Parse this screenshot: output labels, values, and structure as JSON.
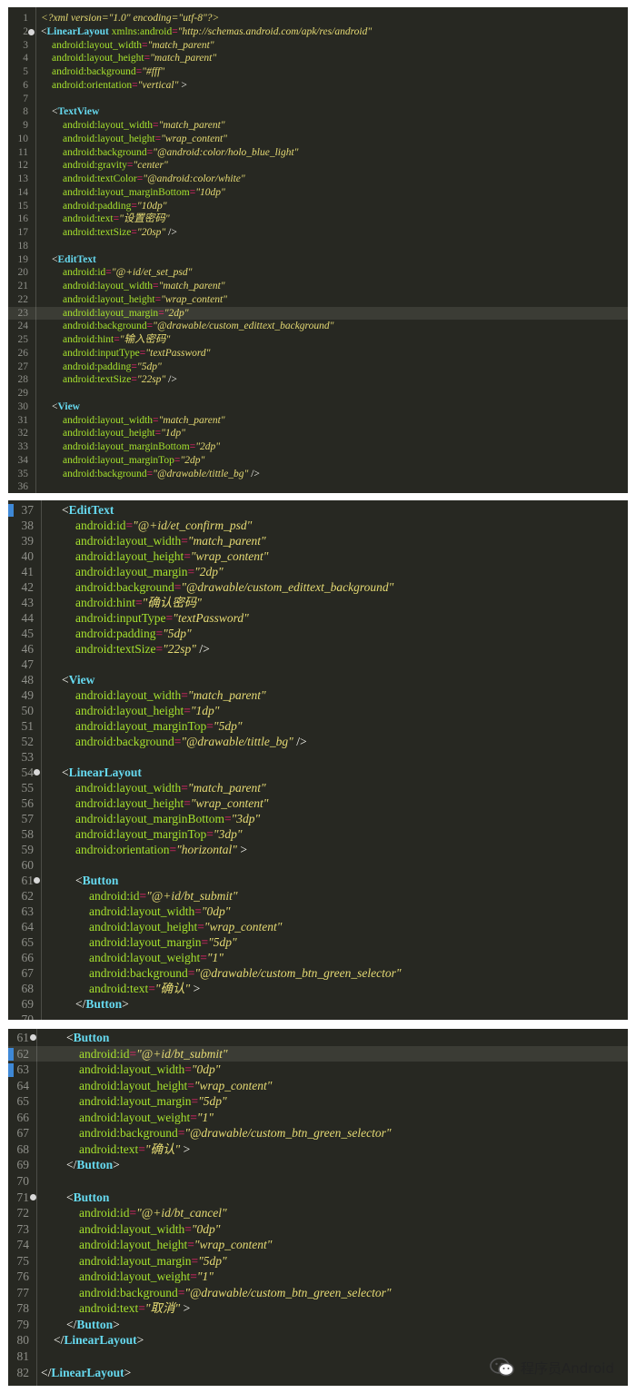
{
  "panels": [
    {
      "lines": [
        {
          "n": "1",
          "c": "decl",
          "text": "<?xml version=\"1.0\" encoding=\"utf-8\"?>"
        },
        {
          "n": "2",
          "c": "open",
          "indent": 0,
          "tag": "LinearLayout",
          "attr": "xmlns:android",
          "val": "\"http://schemas.android.com/apk/res/android\"",
          "fold": true
        },
        {
          "n": "3",
          "c": "attr",
          "indent": 1,
          "attr": "android:layout_width",
          "val": "\"match_parent\""
        },
        {
          "n": "4",
          "c": "attr",
          "indent": 1,
          "attr": "android:layout_height",
          "val": "\"match_parent\""
        },
        {
          "n": "5",
          "c": "attr",
          "indent": 1,
          "attr": "android:background",
          "val": "\"#fff\""
        },
        {
          "n": "6",
          "c": "attr",
          "indent": 1,
          "attr": "android:orientation",
          "val": "\"vertical\"",
          "end": " >"
        },
        {
          "n": "7",
          "c": "blank"
        },
        {
          "n": "8",
          "c": "open",
          "indent": 1,
          "tag": "TextView"
        },
        {
          "n": "9",
          "c": "attr",
          "indent": 2,
          "attr": "android:layout_width",
          "val": "\"match_parent\""
        },
        {
          "n": "10",
          "c": "attr",
          "indent": 2,
          "attr": "android:layout_height",
          "val": "\"wrap_content\""
        },
        {
          "n": "11",
          "c": "attr",
          "indent": 2,
          "attr": "android:background",
          "val": "\"@android:color/holo_blue_light\""
        },
        {
          "n": "12",
          "c": "attr",
          "indent": 2,
          "attr": "android:gravity",
          "val": "\"center\""
        },
        {
          "n": "13",
          "c": "attr",
          "indent": 2,
          "attr": "android:textColor",
          "val": "\"@android:color/white\""
        },
        {
          "n": "14",
          "c": "attr",
          "indent": 2,
          "attr": "android:layout_marginBottom",
          "val": "\"10dp\""
        },
        {
          "n": "15",
          "c": "attr",
          "indent": 2,
          "attr": "android:padding",
          "val": "\"10dp\""
        },
        {
          "n": "16",
          "c": "attr",
          "indent": 2,
          "attr": "android:text",
          "val": "\"设置密码\""
        },
        {
          "n": "17",
          "c": "attr",
          "indent": 2,
          "attr": "android:textSize",
          "val": "\"20sp\"",
          "end": " />"
        },
        {
          "n": "18",
          "c": "blank"
        },
        {
          "n": "19",
          "c": "open",
          "indent": 1,
          "tag": "EditText"
        },
        {
          "n": "20",
          "c": "attr",
          "indent": 2,
          "attr": "android:id",
          "val": "\"@+id/et_set_psd\""
        },
        {
          "n": "21",
          "c": "attr",
          "indent": 2,
          "attr": "android:layout_width",
          "val": "\"match_parent\""
        },
        {
          "n": "22",
          "c": "attr",
          "indent": 2,
          "attr": "android:layout_height",
          "val": "\"wrap_content\""
        },
        {
          "n": "23",
          "c": "attr",
          "indent": 2,
          "attr": "android:layout_margin",
          "val": "\"2dp\"",
          "hl": true
        },
        {
          "n": "24",
          "c": "attr",
          "indent": 2,
          "attr": "android:background",
          "val": "\"@drawable/custom_edittext_background\""
        },
        {
          "n": "25",
          "c": "attr",
          "indent": 2,
          "attr": "android:hint",
          "val": "\"输入密码\""
        },
        {
          "n": "26",
          "c": "attr",
          "indent": 2,
          "attr": "android:inputType",
          "val": "\"textPassword\""
        },
        {
          "n": "27",
          "c": "attr",
          "indent": 2,
          "attr": "android:padding",
          "val": "\"5dp\""
        },
        {
          "n": "28",
          "c": "attr",
          "indent": 2,
          "attr": "android:textSize",
          "val": "\"22sp\"",
          "end": " />"
        },
        {
          "n": "29",
          "c": "blank"
        },
        {
          "n": "30",
          "c": "open",
          "indent": 1,
          "tag": "View"
        },
        {
          "n": "31",
          "c": "attr",
          "indent": 2,
          "attr": "android:layout_width",
          "val": "\"match_parent\""
        },
        {
          "n": "32",
          "c": "attr",
          "indent": 2,
          "attr": "android:layout_height",
          "val": "\"1dp\""
        },
        {
          "n": "33",
          "c": "attr",
          "indent": 2,
          "attr": "android:layout_marginBottom",
          "val": "\"2dp\""
        },
        {
          "n": "34",
          "c": "attr",
          "indent": 2,
          "attr": "android:layout_marginTop",
          "val": "\"2dp\""
        },
        {
          "n": "35",
          "c": "attr",
          "indent": 2,
          "attr": "android:background",
          "val": "\"@drawable/tittle_bg\"",
          "end": " />"
        },
        {
          "n": "36",
          "c": "blank"
        }
      ]
    },
    {
      "lines": [
        {
          "n": "37",
          "c": "open",
          "indent": 1,
          "tag": "EditText",
          "mark": true
        },
        {
          "n": "38",
          "c": "attr",
          "indent": 2,
          "attr": "android:id",
          "val": "\"@+id/et_confirm_psd\""
        },
        {
          "n": "39",
          "c": "attr",
          "indent": 2,
          "attr": "android:layout_width",
          "val": "\"match_parent\""
        },
        {
          "n": "40",
          "c": "attr",
          "indent": 2,
          "attr": "android:layout_height",
          "val": "\"wrap_content\""
        },
        {
          "n": "41",
          "c": "attr",
          "indent": 2,
          "attr": "android:layout_margin",
          "val": "\"2dp\""
        },
        {
          "n": "42",
          "c": "attr",
          "indent": 2,
          "attr": "android:background",
          "val": "\"@drawable/custom_edittext_background\""
        },
        {
          "n": "43",
          "c": "attr",
          "indent": 2,
          "attr": "android:hint",
          "val": "\"确认密码\""
        },
        {
          "n": "44",
          "c": "attr",
          "indent": 2,
          "attr": "android:inputType",
          "val": "\"textPassword\""
        },
        {
          "n": "45",
          "c": "attr",
          "indent": 2,
          "attr": "android:padding",
          "val": "\"5dp\""
        },
        {
          "n": "46",
          "c": "attr",
          "indent": 2,
          "attr": "android:textSize",
          "val": "\"22sp\"",
          "end": " />"
        },
        {
          "n": "47",
          "c": "blank"
        },
        {
          "n": "48",
          "c": "open",
          "indent": 1,
          "tag": "View"
        },
        {
          "n": "49",
          "c": "attr",
          "indent": 2,
          "attr": "android:layout_width",
          "val": "\"match_parent\""
        },
        {
          "n": "50",
          "c": "attr",
          "indent": 2,
          "attr": "android:layout_height",
          "val": "\"1dp\""
        },
        {
          "n": "51",
          "c": "attr",
          "indent": 2,
          "attr": "android:layout_marginTop",
          "val": "\"5dp\""
        },
        {
          "n": "52",
          "c": "attr",
          "indent": 2,
          "attr": "android:background",
          "val": "\"@drawable/tittle_bg\"",
          "end": " />"
        },
        {
          "n": "53",
          "c": "blank"
        },
        {
          "n": "54",
          "c": "open",
          "indent": 1,
          "tag": "LinearLayout",
          "fold": true
        },
        {
          "n": "55",
          "c": "attr",
          "indent": 2,
          "attr": "android:layout_width",
          "val": "\"match_parent\""
        },
        {
          "n": "56",
          "c": "attr",
          "indent": 2,
          "attr": "android:layout_height",
          "val": "\"wrap_content\""
        },
        {
          "n": "57",
          "c": "attr",
          "indent": 2,
          "attr": "android:layout_marginBottom",
          "val": "\"3dp\""
        },
        {
          "n": "58",
          "c": "attr",
          "indent": 2,
          "attr": "android:layout_marginTop",
          "val": "\"3dp\""
        },
        {
          "n": "59",
          "c": "attr",
          "indent": 2,
          "attr": "android:orientation",
          "val": "\"horizontal\"",
          "end": " >"
        },
        {
          "n": "60",
          "c": "blank"
        },
        {
          "n": "61",
          "c": "open",
          "indent": 2,
          "tag": "Button",
          "fold": true
        },
        {
          "n": "62",
          "c": "attr",
          "indent": 3,
          "attr": "android:id",
          "val": "\"@+id/bt_submit\""
        },
        {
          "n": "63",
          "c": "attr",
          "indent": 3,
          "attr": "android:layout_width",
          "val": "\"0dp\""
        },
        {
          "n": "64",
          "c": "attr",
          "indent": 3,
          "attr": "android:layout_height",
          "val": "\"wrap_content\""
        },
        {
          "n": "65",
          "c": "attr",
          "indent": 3,
          "attr": "android:layout_margin",
          "val": "\"5dp\""
        },
        {
          "n": "66",
          "c": "attr",
          "indent": 3,
          "attr": "android:layout_weight",
          "val": "\"1\""
        },
        {
          "n": "67",
          "c": "attr",
          "indent": 3,
          "attr": "android:background",
          "val": "\"@drawable/custom_btn_green_selector\""
        },
        {
          "n": "68",
          "c": "attr",
          "indent": 3,
          "attr": "android:text",
          "val": "\"确认\"",
          "end": " >"
        },
        {
          "n": "69",
          "c": "close",
          "indent": 2,
          "tag": "Button"
        },
        {
          "n": "70",
          "c": "blank"
        }
      ]
    },
    {
      "lines": [
        {
          "n": "61",
          "c": "open",
          "indent": 2,
          "tag": "Button",
          "fold": true
        },
        {
          "n": "62",
          "c": "attr",
          "indent": 3,
          "attr": "android:id",
          "val": "\"@+id/bt_submit\"",
          "hl": true,
          "mark": true
        },
        {
          "n": "63",
          "c": "attr",
          "indent": 3,
          "attr": "android:layout_width",
          "val": "\"0dp\"",
          "mark": true
        },
        {
          "n": "64",
          "c": "attr",
          "indent": 3,
          "attr": "android:layout_height",
          "val": "\"wrap_content\""
        },
        {
          "n": "65",
          "c": "attr",
          "indent": 3,
          "attr": "android:layout_margin",
          "val": "\"5dp\""
        },
        {
          "n": "66",
          "c": "attr",
          "indent": 3,
          "attr": "android:layout_weight",
          "val": "\"1\""
        },
        {
          "n": "67",
          "c": "attr",
          "indent": 3,
          "attr": "android:background",
          "val": "\"@drawable/custom_btn_green_selector\""
        },
        {
          "n": "68",
          "c": "attr",
          "indent": 3,
          "attr": "android:text",
          "val": "\"确认\"",
          "end": " >"
        },
        {
          "n": "69",
          "c": "close",
          "indent": 2,
          "tag": "Button"
        },
        {
          "n": "70",
          "c": "blank"
        },
        {
          "n": "71",
          "c": "open",
          "indent": 2,
          "tag": "Button",
          "fold": true
        },
        {
          "n": "72",
          "c": "attr",
          "indent": 3,
          "attr": "android:id",
          "val": "\"@+id/bt_cancel\""
        },
        {
          "n": "73",
          "c": "attr",
          "indent": 3,
          "attr": "android:layout_width",
          "val": "\"0dp\""
        },
        {
          "n": "74",
          "c": "attr",
          "indent": 3,
          "attr": "android:layout_height",
          "val": "\"wrap_content\""
        },
        {
          "n": "75",
          "c": "attr",
          "indent": 3,
          "attr": "android:layout_margin",
          "val": "\"5dp\""
        },
        {
          "n": "76",
          "c": "attr",
          "indent": 3,
          "attr": "android:layout_weight",
          "val": "\"1\""
        },
        {
          "n": "77",
          "c": "attr",
          "indent": 3,
          "attr": "android:background",
          "val": "\"@drawable/custom_btn_green_selector\""
        },
        {
          "n": "78",
          "c": "attr",
          "indent": 3,
          "attr": "android:text",
          "val": "\"取消\"",
          "end": " >"
        },
        {
          "n": "79",
          "c": "close",
          "indent": 2,
          "tag": "Button"
        },
        {
          "n": "80",
          "c": "close",
          "indent": 1,
          "tag": "LinearLayout"
        },
        {
          "n": "81",
          "c": "blank"
        },
        {
          "n": "82",
          "c": "close",
          "indent": 0,
          "tag": "LinearLayout"
        }
      ]
    }
  ],
  "watermark": {
    "text": "程序员Android",
    "icon": "wechat-icon"
  },
  "colors": {
    "editor_bg": "#272822",
    "tag": "#66d9ef",
    "attribute": "#a6e22e",
    "equals": "#f92672",
    "value": "#e6db74",
    "line_number": "#8f908a"
  }
}
